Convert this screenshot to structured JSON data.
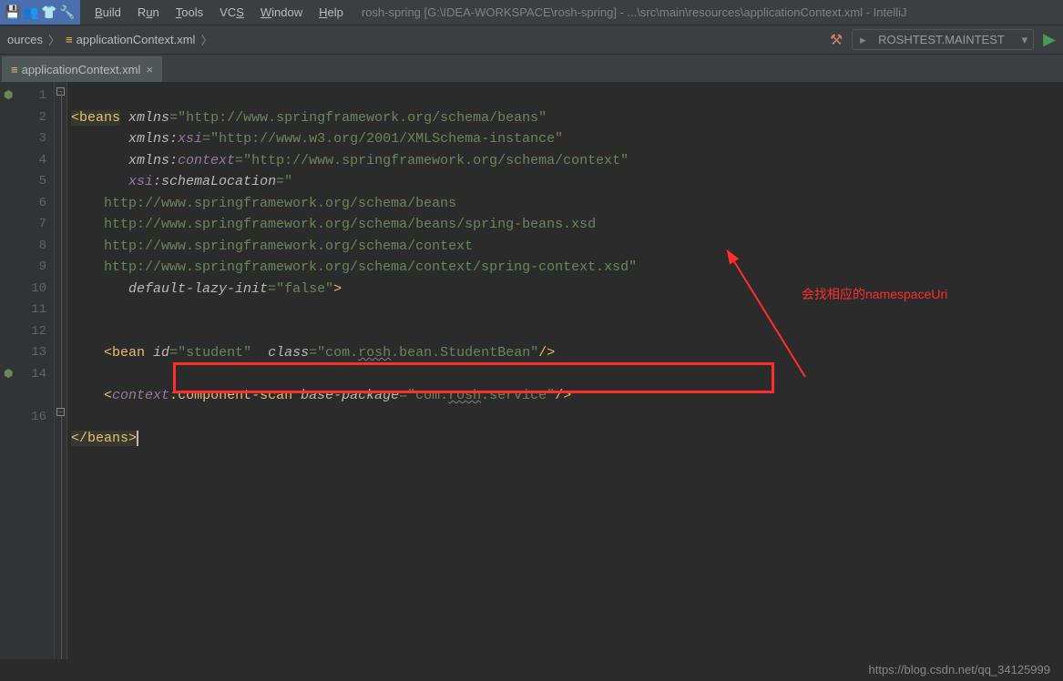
{
  "window": {
    "title": "rosh-spring [G:\\IDEA-WORKSPACE\\rosh-spring] - ...\\src\\main\\resources\\applicationContext.xml - IntelliJ"
  },
  "menu": {
    "build": {
      "label": "Build",
      "accel": "B"
    },
    "run": {
      "label": "Run",
      "accel": "u"
    },
    "tools": {
      "label": "Tools",
      "accel": "T"
    },
    "vcs": {
      "label": "VCS",
      "accel": "S"
    },
    "window": {
      "label": "Window",
      "accel": "W"
    },
    "help": {
      "label": "Help",
      "accel": "H"
    }
  },
  "breadcrumb": {
    "item1": "ources",
    "item2": "applicationContext.xml"
  },
  "run_config": {
    "name": "ROSHTEST.MAINTEST"
  },
  "tab": {
    "filename": "applicationContext.xml"
  },
  "gutter": {
    "lines": [
      "1",
      "2",
      "3",
      "4",
      "5",
      "6",
      "7",
      "8",
      "9",
      "10",
      "11",
      "12",
      "13",
      "14",
      "",
      "16"
    ]
  },
  "code": {
    "l1a": "<",
    "l1b": "beans",
    "l1c": "xmlns",
    "l1d": "=",
    "l1e": "\"http://www.springframework.org/schema/beans\"",
    "l2a": "xmlns:",
    "l2b": "xsi",
    "l2c": "=",
    "l2d": "\"http://www.w3.org/2001/XMLSchema-instance\"",
    "l3a": "xmlns:",
    "l3b": "context",
    "l3c": "=",
    "l3d": "\"http://www.springframework.org/schema/context\"",
    "l4a": "xsi",
    "l4b": ":",
    "l4c": "schemaLocation",
    "l4d": "=",
    "l4e": "\"",
    "l5": "http://www.springframework.org/schema/beans",
    "l6": "http://www.springframework.org/schema/beans/spring-beans.xsd",
    "l7": "http://www.springframework.org/schema/context",
    "l8": "http://www.springframework.org/schema/context/spring-context.xsd",
    "l8q": "\"",
    "l9a": "default-lazy-init",
    "l9b": "=",
    "l9c": "\"false\"",
    "l9d": ">",
    "l12a": "<",
    "l12b": "bean ",
    "l12c": "id",
    "l12d": "=",
    "l12e": "\"student\"",
    "l12f": "class",
    "l12g": "=",
    "l12h": "\"com.",
    "l12h2": "rosh",
    "l12h3": ".bean.StudentBean\"",
    "l12i": "/>",
    "l14a": "<",
    "l14b": "context",
    "l14c": ":",
    "l14d": "component-scan ",
    "l14e": "base-package",
    "l14f": "=",
    "l14g": "\"com.",
    "l14g2": "rosh",
    "l14g3": ".service\"",
    "l14h": "/>",
    "l16a": "</",
    "l16b": "beans",
    "l16c": ">"
  },
  "annotation": {
    "text": "会找相应的namespaceUri"
  },
  "footer": {
    "watermark": "https://blog.csdn.net/qq_34125999"
  }
}
